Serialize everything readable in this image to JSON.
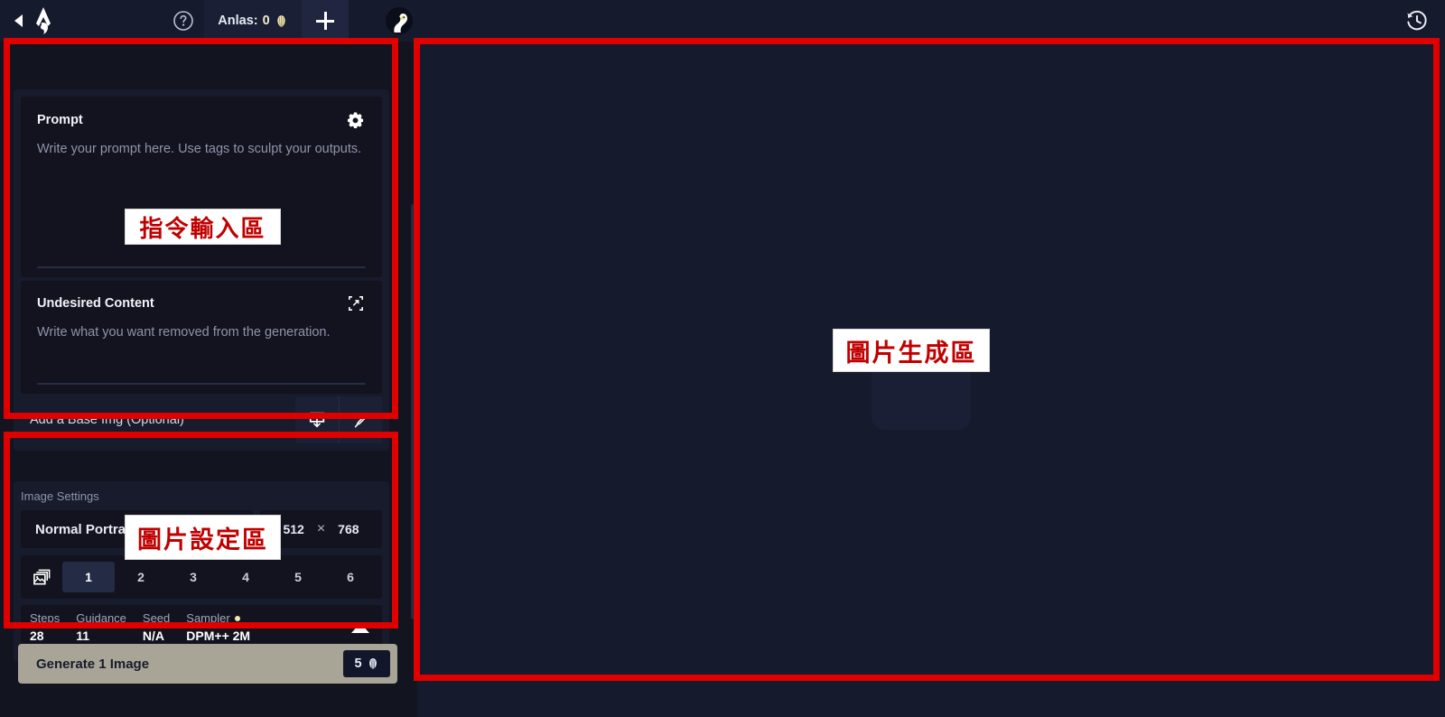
{
  "topbar": {
    "collapse_icon": "collapse-left-arrow-icon",
    "logo_icon": "novelai-logo-icon",
    "help_icon": "help-circle-icon",
    "anlas_label": "Anlas:",
    "anlas_value": "0",
    "anlas_currency_icon": "anlas-shell-icon",
    "add_anlas_icon": "plus-icon",
    "avatar_icon": "goose-avatar-icon",
    "history_icon": "history-clock-icon"
  },
  "prompt_panel": {
    "prompt": {
      "title": "Prompt",
      "placeholder": "Write your prompt here. Use tags to sculpt your outputs.",
      "settings_icon": "gear-icon"
    },
    "undesired": {
      "title": "Undesired Content",
      "placeholder": "Write what you want removed from the generation.",
      "expand_icon": "expand-box-icon"
    },
    "base_image": {
      "label": "Add a Base Img (Optional)",
      "upload_icon": "upload-image-icon",
      "paint_icon": "paintbrush-icon"
    }
  },
  "image_settings": {
    "title": "Image Settings",
    "preset": "Normal Portrait",
    "preset_chevron_icon": "chevron-down-icon",
    "width": "512",
    "separator": "×",
    "height": "768",
    "quantity_icon": "stacked-images-icon",
    "quantity_options": [
      "1",
      "2",
      "3",
      "4",
      "5",
      "6"
    ],
    "quantity_selected": "1",
    "params": [
      {
        "label": "Steps",
        "value": "28",
        "has_dot": false
      },
      {
        "label": "Guidance",
        "value": "11",
        "has_dot": false
      },
      {
        "label": "Seed",
        "value": "N/A",
        "has_dot": false
      },
      {
        "label": "Sampler",
        "value": "DPM++ 2M",
        "has_dot": true
      }
    ],
    "collapse_icon": "caret-up-icon"
  },
  "generate": {
    "label": "Generate 1 Image",
    "cost": "5",
    "cost_icon": "anlas-shell-icon"
  },
  "annotations": {
    "prompt_area": "指令輸入區",
    "settings_area": "圖片設定區",
    "canvas_area": "圖片生成區",
    "box_color": "#e00000"
  },
  "colors": {
    "app_background": "#12141f",
    "panel_background": "#171b2c",
    "field_background": "#12131f",
    "canvas_background": "#161a2d",
    "accent_selected": "#242b45",
    "generate_button": "#a8a496",
    "annotation_red": "#c00000",
    "anlas_yellow": "#f0ecd0"
  }
}
